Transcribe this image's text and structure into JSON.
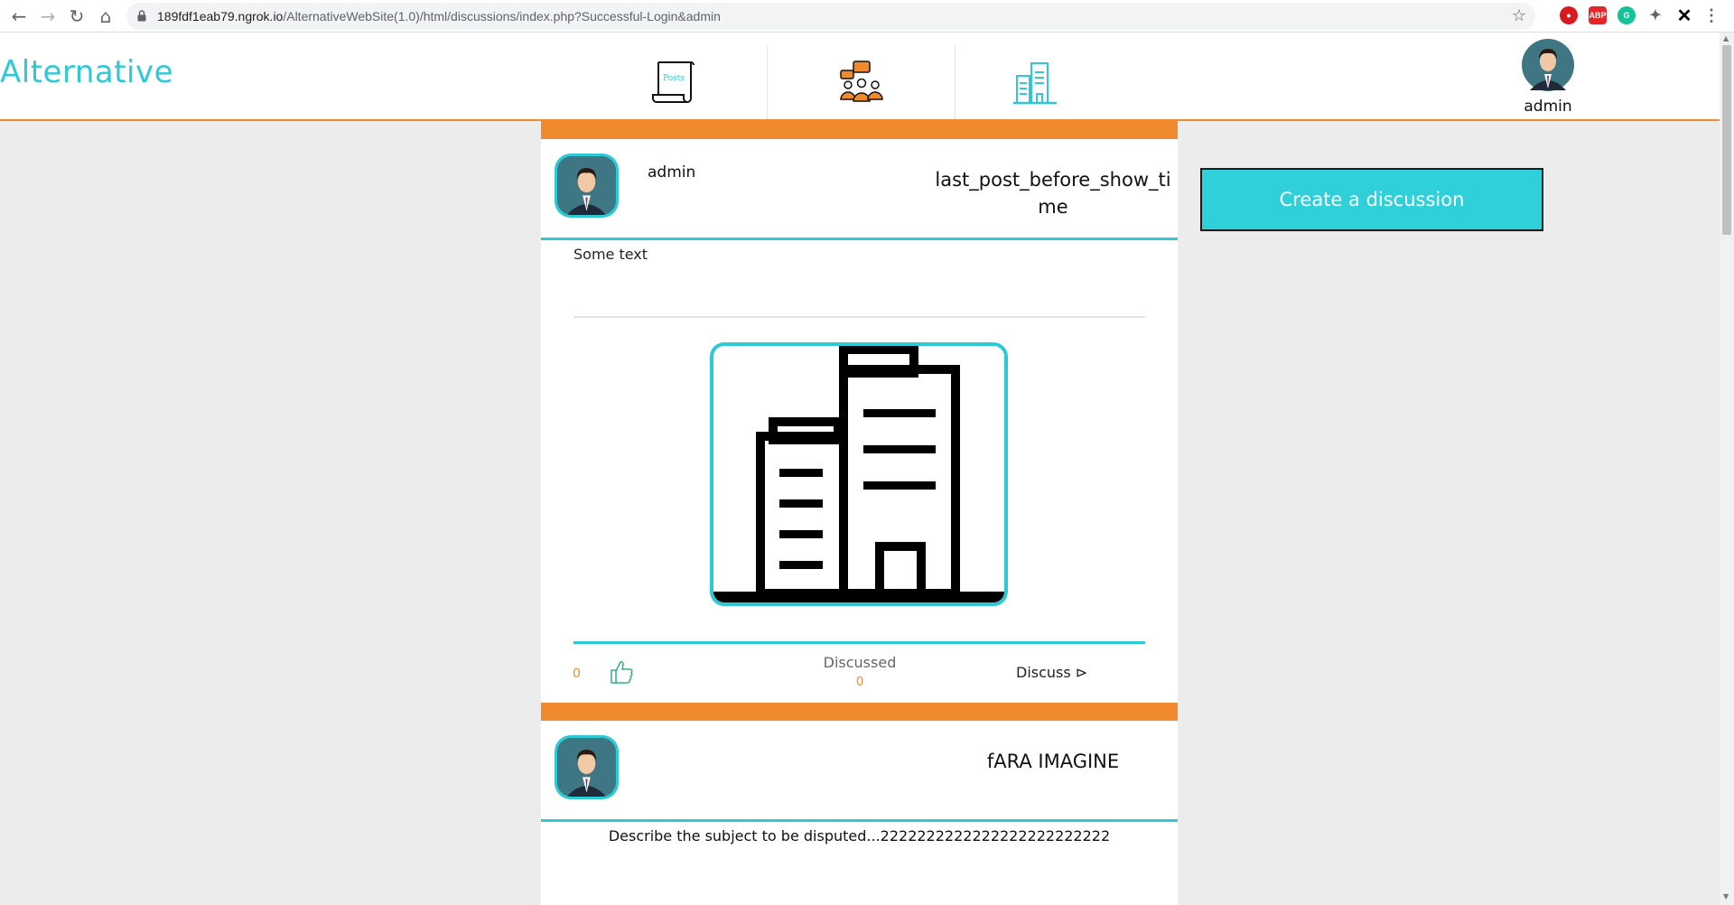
{
  "browser": {
    "url_host": "189fdf1eab79.ngrok.io",
    "url_path": "/AlternativeWebSite(1.0)/html/discussions/index.php?Successful-Login&admin",
    "extensions": [
      {
        "name": "opera-extension-icon",
        "color": "#d71920",
        "glyph": ""
      },
      {
        "name": "adblock-icon",
        "color": "#e2262a",
        "glyph": "ABP"
      },
      {
        "name": "grammarly-icon",
        "color": "#15c39a",
        "glyph": "G"
      }
    ]
  },
  "header": {
    "logo": "Alternative",
    "nav": {
      "posts_icon_text": "Posts"
    },
    "user": {
      "name": "admin"
    }
  },
  "sidebar": {
    "create_button": "Create a discussion"
  },
  "posts": [
    {
      "author": "admin",
      "title": "last_post_before_show_time",
      "text": "Some text",
      "likes": "0",
      "discussed_label": "Discussed",
      "discussed_count": "0",
      "discuss_link": "Discuss ⊳"
    },
    {
      "author": "",
      "title": "fARA IMAGINE",
      "text": "Describe the subject to be disputed...2222222222222222222222222"
    }
  ],
  "colors": {
    "accent": "#2fc9d6",
    "orange": "#f08a2e",
    "button": "#2fd0da"
  }
}
